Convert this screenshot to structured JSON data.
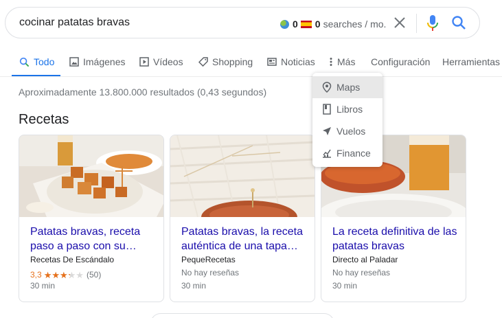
{
  "search": {
    "query": "cocinar patatas bravas",
    "ext_count_a": "0",
    "ext_count_b": "0",
    "ext_label": "searches / mo.",
    "icons": [
      "globe-icon",
      "spain-flag-icon",
      "close-icon",
      "microphone-icon",
      "search-icon"
    ]
  },
  "tabs": [
    {
      "label": "Todo",
      "icon": "search-icon",
      "active": true
    },
    {
      "label": "Imágenes",
      "icon": "image-icon"
    },
    {
      "label": "Vídeos",
      "icon": "play-icon"
    },
    {
      "label": "Shopping",
      "icon": "tag-icon"
    },
    {
      "label": "Noticias",
      "icon": "newspaper-icon"
    },
    {
      "label": "Más",
      "icon": "more-vert-icon"
    },
    {
      "label": "Configuración"
    },
    {
      "label": "Herramientas"
    }
  ],
  "results": {
    "stats": "Aproximadamente 13.800.000 resultados (0,43 segundos)"
  },
  "recipes": {
    "title": "Recetas",
    "cards": [
      {
        "title": "Patatas bravas, receta paso a paso con su…",
        "source": "Recetas De Escándalo",
        "rating_text": "3,3",
        "rating_value": 3.3,
        "reviews": "(50)",
        "time": "30 min"
      },
      {
        "title": "Patatas bravas, la receta auténtica de una tapa…",
        "source": "PequeRecetas",
        "reviews_text": "No hay reseñas",
        "time": "30 min"
      },
      {
        "title": "La receta definitiva de las patatas bravas",
        "source": "Directo al Paladar",
        "reviews_text": "No hay reseñas",
        "time": "30 min"
      }
    ]
  },
  "more_menu": {
    "items": [
      {
        "label": "Maps",
        "icon": "map-pin-icon",
        "highlighted": true
      },
      {
        "label": "Libros",
        "icon": "book-icon"
      },
      {
        "label": "Vuelos",
        "icon": "airplane-icon"
      },
      {
        "label": "Finance",
        "icon": "finance-icon"
      }
    ]
  },
  "colors": {
    "accent": "#1a73e8",
    "link": "#1a0dab",
    "rating": "#e7711b",
    "muted": "#70757a"
  }
}
